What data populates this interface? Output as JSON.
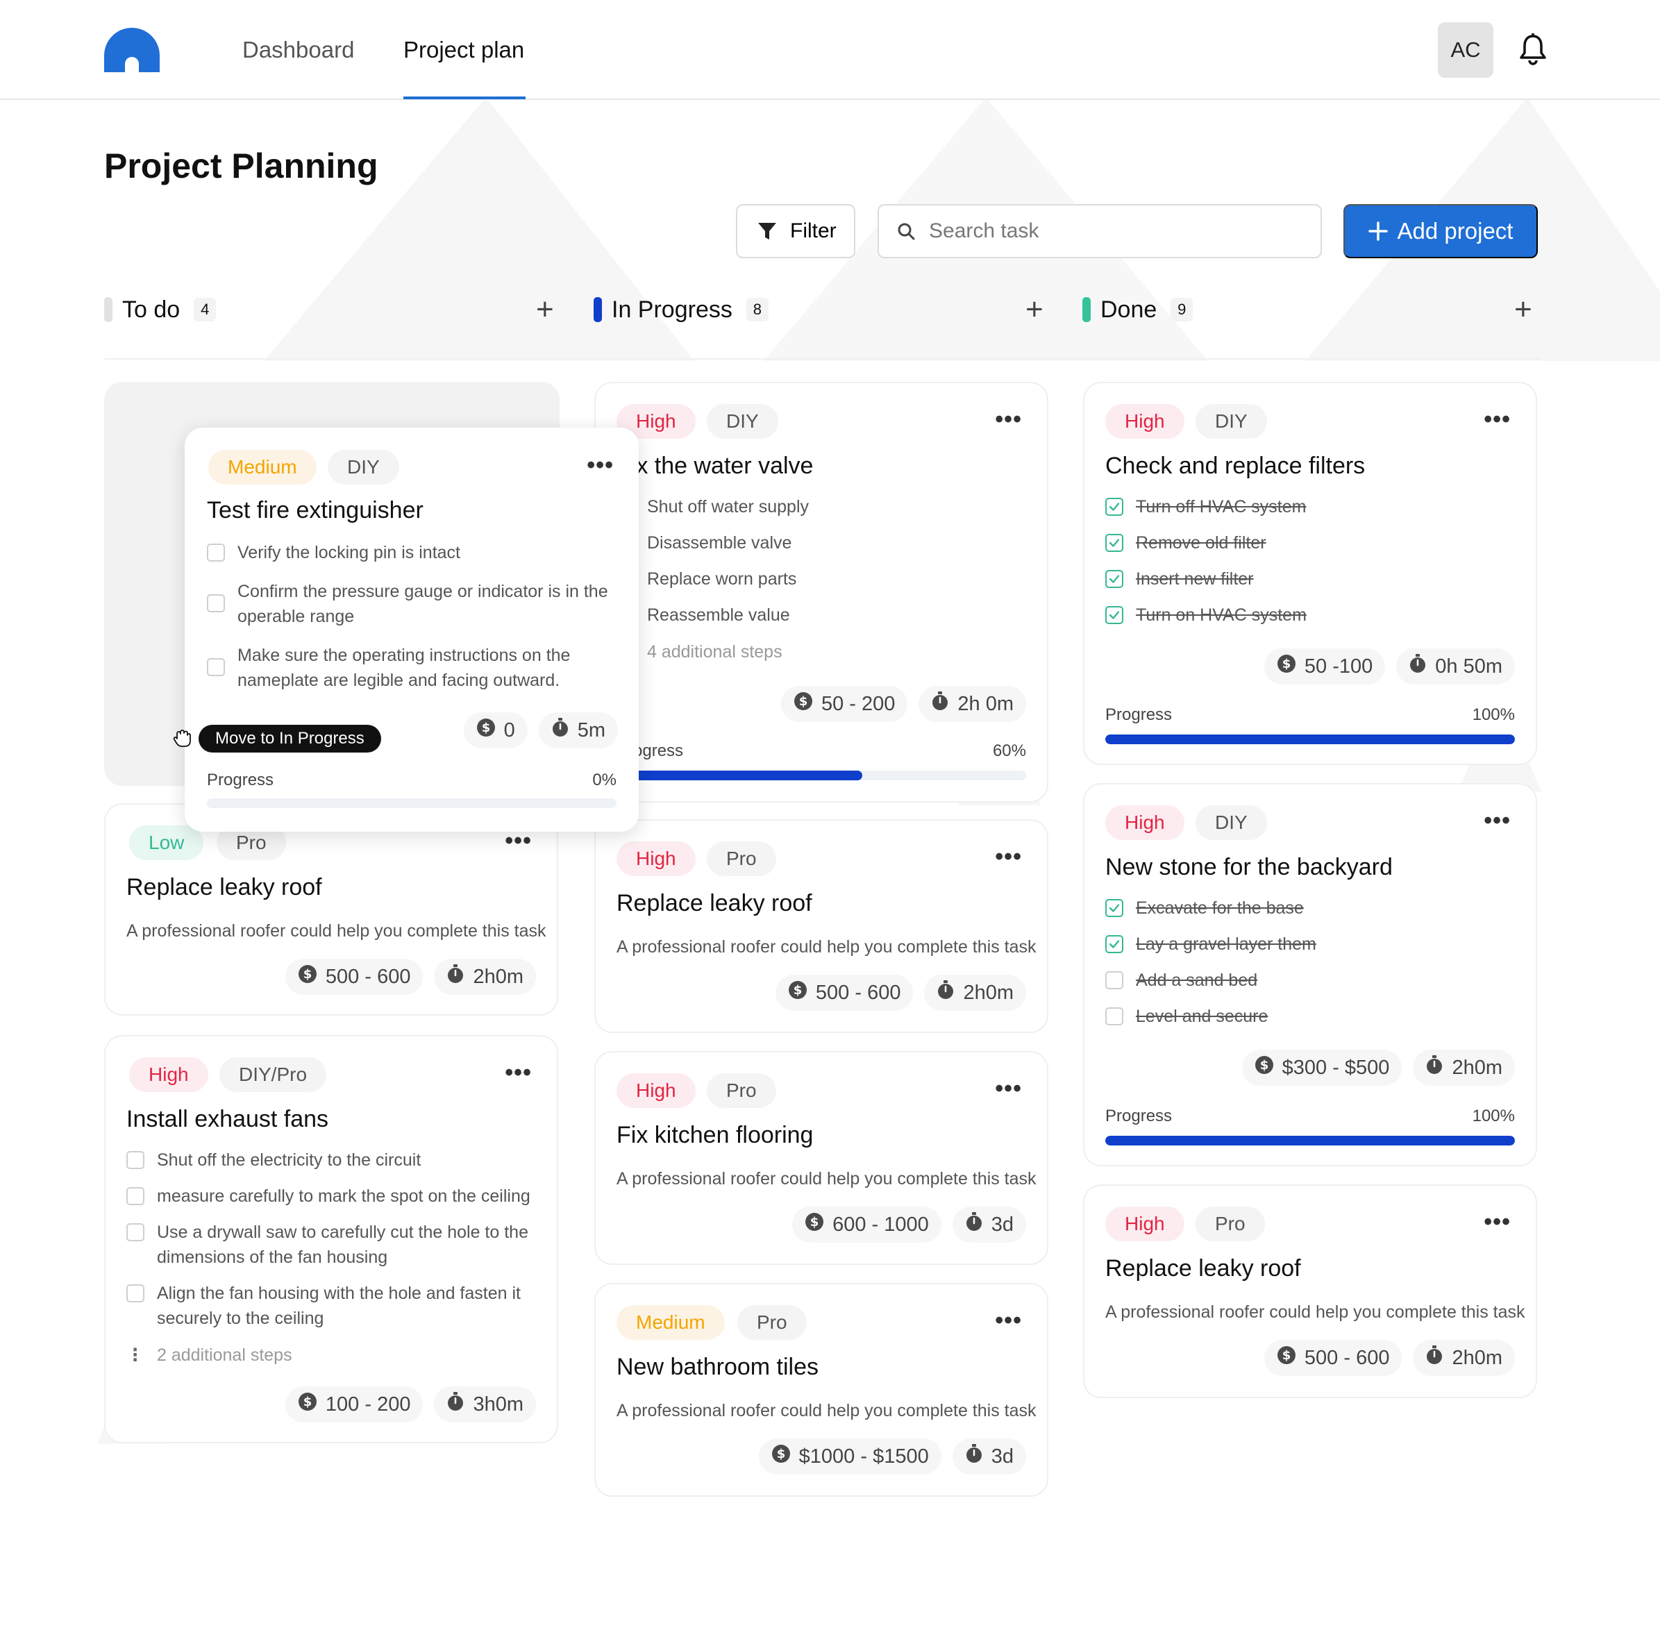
{
  "nav": {
    "tabs": [
      {
        "label": "Dashboard"
      },
      {
        "label": "Project plan"
      }
    ],
    "active_tab": "Project plan",
    "avatar_initials": "AC",
    "accent_color": "#1f6fd6"
  },
  "page": {
    "title": "Project Planning",
    "filter_label": "Filter",
    "search_placeholder": "Search task",
    "add_label": "Add project"
  },
  "columns": [
    {
      "title": "To do",
      "count": "4",
      "color": "#e2e2e2"
    },
    {
      "title": "In Progress",
      "count": "8",
      "color": "#0f3fcb"
    },
    {
      "title": "Done",
      "count": "9",
      "color": "#35c39c"
    }
  ],
  "dragging": {
    "priority": "Medium",
    "kind": "DIY",
    "title": "Test fire extinguisher",
    "steps": [
      "Verify the locking pin is intact",
      "Confirm the pressure gauge or indicator is in the operable range",
      "Make sure the operating instructions on the nameplate are legible and facing outward."
    ],
    "cost": "0",
    "time": "5m",
    "progress_label": "Progress",
    "progress_text": "0%",
    "progress": 0,
    "tooltip": "Move to In Progress"
  },
  "todo": [
    {
      "priority": "Low",
      "kind": "Pro",
      "title": "Replace leaky roof",
      "description": "A professional roofer could help you complete this task",
      "cost": "500 - 600",
      "time": "2h0m"
    },
    {
      "priority": "High",
      "kind": "DIY/Pro",
      "title": "Install exhaust fans",
      "steps": [
        "Shut off the electricity to the circuit",
        "measure carefully to mark the spot on the ceiling",
        "Use a drywall saw to carefully cut the hole to the dimensions of the fan housing",
        "Align the fan housing with the hole and fasten it securely to the ceiling"
      ],
      "more_steps": "2 additional steps",
      "cost": "100 - 200",
      "time": "3h0m"
    }
  ],
  "in_progress": [
    {
      "priority": "High",
      "kind": "DIY",
      "title": "Fix the water valve",
      "steps": [
        "Shut off water supply",
        "Disassemble valve",
        "Replace worn parts",
        "Reassemble value"
      ],
      "more_steps": "4 additional steps",
      "cost": "50 - 200",
      "time": "2h 0m",
      "progress_label": "Progress",
      "progress_text": "60%",
      "progress": 0.6
    },
    {
      "priority": "High",
      "kind": "Pro",
      "title": "Replace leaky roof",
      "description": "A professional roofer could help you complete this task",
      "cost": "500 - 600",
      "time": "2h0m"
    },
    {
      "priority": "High",
      "kind": "Pro",
      "title": "Fix kitchen flooring",
      "description": "A professional roofer could help you complete this task",
      "cost": "600 - 1000",
      "time": "3d"
    },
    {
      "priority": "Medium",
      "kind": "Pro",
      "title": "New bathroom tiles",
      "description": "A professional roofer could help you complete this task",
      "cost": "$1000 - $1500",
      "time": "3d"
    }
  ],
  "done": [
    {
      "priority": "High",
      "kind": "DIY",
      "title": "Check and replace filters",
      "steps": [
        "Turn off HVAC system",
        "Remove old filter",
        "Insert new filter",
        "Turn on HVAC system"
      ],
      "checked": [
        true,
        true,
        true,
        true
      ],
      "cost": "50 -100",
      "time": "0h 50m",
      "progress_label": "Progress",
      "progress_text": "100%",
      "progress": 1.0
    },
    {
      "priority": "High",
      "kind": "DIY",
      "title": "New stone for the backyard",
      "steps": [
        "Excavate for the base",
        "Lay a gravel layer them",
        "Add a sand bed",
        "Level and secure"
      ],
      "checked": [
        true,
        true,
        false,
        false
      ],
      "cost": "$300 - $500",
      "time": "2h0m",
      "progress_label": "Progress",
      "progress_text": "100%",
      "progress": 1.0
    },
    {
      "priority": "High",
      "kind": "Pro",
      "title": "Replace leaky roof",
      "description": "A professional roofer could help you complete this task",
      "cost": "500 - 600",
      "time": "2h0m"
    }
  ]
}
